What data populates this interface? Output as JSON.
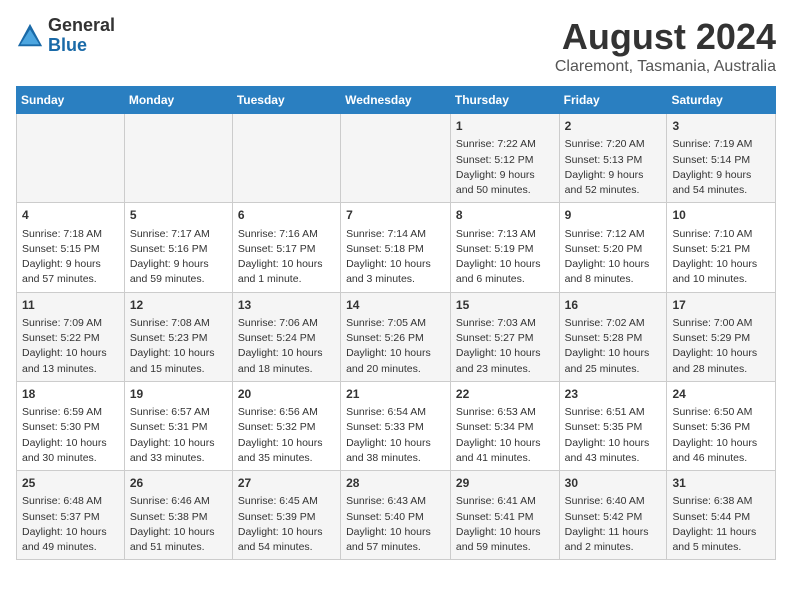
{
  "header": {
    "logo_general": "General",
    "logo_blue": "Blue",
    "main_title": "August 2024",
    "subtitle": "Claremont, Tasmania, Australia"
  },
  "days_of_week": [
    "Sunday",
    "Monday",
    "Tuesday",
    "Wednesday",
    "Thursday",
    "Friday",
    "Saturday"
  ],
  "weeks": [
    {
      "days": [
        {
          "num": "",
          "content": ""
        },
        {
          "num": "",
          "content": ""
        },
        {
          "num": "",
          "content": ""
        },
        {
          "num": "",
          "content": ""
        },
        {
          "num": "1",
          "content": "Sunrise: 7:22 AM\nSunset: 5:12 PM\nDaylight: 9 hours\nand 50 minutes."
        },
        {
          "num": "2",
          "content": "Sunrise: 7:20 AM\nSunset: 5:13 PM\nDaylight: 9 hours\nand 52 minutes."
        },
        {
          "num": "3",
          "content": "Sunrise: 7:19 AM\nSunset: 5:14 PM\nDaylight: 9 hours\nand 54 minutes."
        }
      ]
    },
    {
      "days": [
        {
          "num": "4",
          "content": "Sunrise: 7:18 AM\nSunset: 5:15 PM\nDaylight: 9 hours\nand 57 minutes."
        },
        {
          "num": "5",
          "content": "Sunrise: 7:17 AM\nSunset: 5:16 PM\nDaylight: 9 hours\nand 59 minutes."
        },
        {
          "num": "6",
          "content": "Sunrise: 7:16 AM\nSunset: 5:17 PM\nDaylight: 10 hours\nand 1 minute."
        },
        {
          "num": "7",
          "content": "Sunrise: 7:14 AM\nSunset: 5:18 PM\nDaylight: 10 hours\nand 3 minutes."
        },
        {
          "num": "8",
          "content": "Sunrise: 7:13 AM\nSunset: 5:19 PM\nDaylight: 10 hours\nand 6 minutes."
        },
        {
          "num": "9",
          "content": "Sunrise: 7:12 AM\nSunset: 5:20 PM\nDaylight: 10 hours\nand 8 minutes."
        },
        {
          "num": "10",
          "content": "Sunrise: 7:10 AM\nSunset: 5:21 PM\nDaylight: 10 hours\nand 10 minutes."
        }
      ]
    },
    {
      "days": [
        {
          "num": "11",
          "content": "Sunrise: 7:09 AM\nSunset: 5:22 PM\nDaylight: 10 hours\nand 13 minutes."
        },
        {
          "num": "12",
          "content": "Sunrise: 7:08 AM\nSunset: 5:23 PM\nDaylight: 10 hours\nand 15 minutes."
        },
        {
          "num": "13",
          "content": "Sunrise: 7:06 AM\nSunset: 5:24 PM\nDaylight: 10 hours\nand 18 minutes."
        },
        {
          "num": "14",
          "content": "Sunrise: 7:05 AM\nSunset: 5:26 PM\nDaylight: 10 hours\nand 20 minutes."
        },
        {
          "num": "15",
          "content": "Sunrise: 7:03 AM\nSunset: 5:27 PM\nDaylight: 10 hours\nand 23 minutes."
        },
        {
          "num": "16",
          "content": "Sunrise: 7:02 AM\nSunset: 5:28 PM\nDaylight: 10 hours\nand 25 minutes."
        },
        {
          "num": "17",
          "content": "Sunrise: 7:00 AM\nSunset: 5:29 PM\nDaylight: 10 hours\nand 28 minutes."
        }
      ]
    },
    {
      "days": [
        {
          "num": "18",
          "content": "Sunrise: 6:59 AM\nSunset: 5:30 PM\nDaylight: 10 hours\nand 30 minutes."
        },
        {
          "num": "19",
          "content": "Sunrise: 6:57 AM\nSunset: 5:31 PM\nDaylight: 10 hours\nand 33 minutes."
        },
        {
          "num": "20",
          "content": "Sunrise: 6:56 AM\nSunset: 5:32 PM\nDaylight: 10 hours\nand 35 minutes."
        },
        {
          "num": "21",
          "content": "Sunrise: 6:54 AM\nSunset: 5:33 PM\nDaylight: 10 hours\nand 38 minutes."
        },
        {
          "num": "22",
          "content": "Sunrise: 6:53 AM\nSunset: 5:34 PM\nDaylight: 10 hours\nand 41 minutes."
        },
        {
          "num": "23",
          "content": "Sunrise: 6:51 AM\nSunset: 5:35 PM\nDaylight: 10 hours\nand 43 minutes."
        },
        {
          "num": "24",
          "content": "Sunrise: 6:50 AM\nSunset: 5:36 PM\nDaylight: 10 hours\nand 46 minutes."
        }
      ]
    },
    {
      "days": [
        {
          "num": "25",
          "content": "Sunrise: 6:48 AM\nSunset: 5:37 PM\nDaylight: 10 hours\nand 49 minutes."
        },
        {
          "num": "26",
          "content": "Sunrise: 6:46 AM\nSunset: 5:38 PM\nDaylight: 10 hours\nand 51 minutes."
        },
        {
          "num": "27",
          "content": "Sunrise: 6:45 AM\nSunset: 5:39 PM\nDaylight: 10 hours\nand 54 minutes."
        },
        {
          "num": "28",
          "content": "Sunrise: 6:43 AM\nSunset: 5:40 PM\nDaylight: 10 hours\nand 57 minutes."
        },
        {
          "num": "29",
          "content": "Sunrise: 6:41 AM\nSunset: 5:41 PM\nDaylight: 10 hours\nand 59 minutes."
        },
        {
          "num": "30",
          "content": "Sunrise: 6:40 AM\nSunset: 5:42 PM\nDaylight: 11 hours\nand 2 minutes."
        },
        {
          "num": "31",
          "content": "Sunrise: 6:38 AM\nSunset: 5:44 PM\nDaylight: 11 hours\nand 5 minutes."
        }
      ]
    }
  ]
}
